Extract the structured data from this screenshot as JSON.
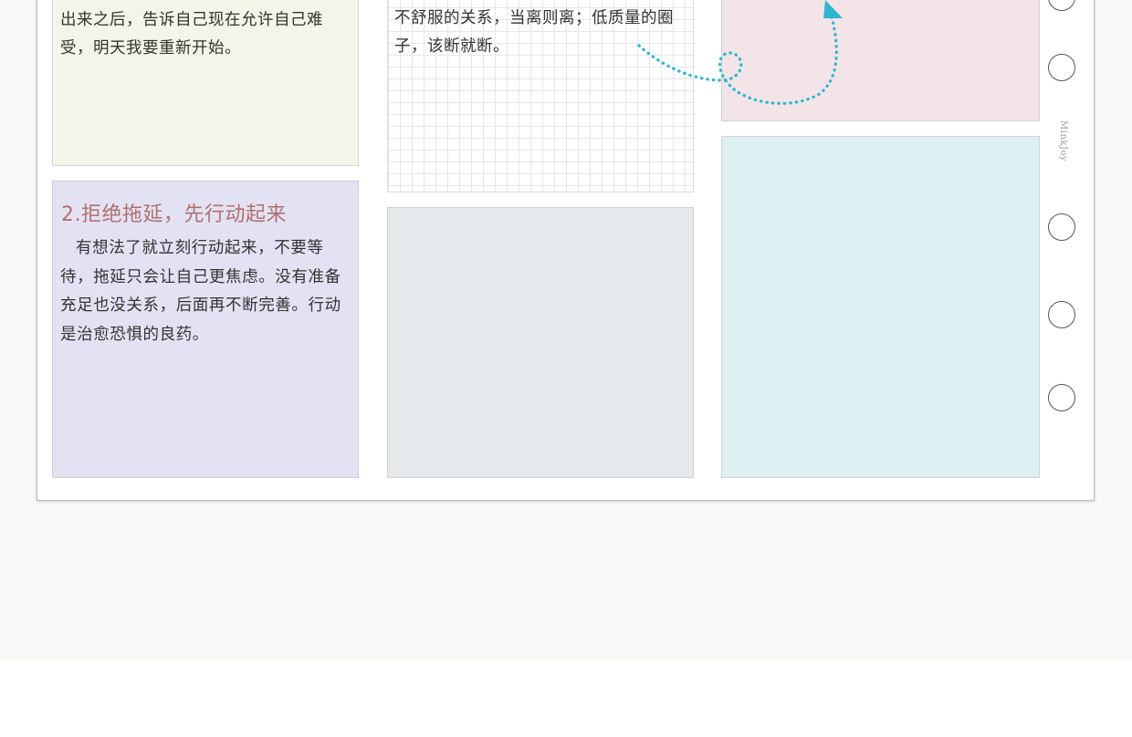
{
  "sheet": {
    "brand": "MinkJoy"
  },
  "notes": {
    "green": {
      "body": "出来之后，告诉自己现在允许自己难受，明天我要重新开始。"
    },
    "grid": {
      "body": "不舒服的关系，当离则离；低质量的圈子，该断就断。"
    },
    "purple": {
      "title": "2.拒绝拖延，先行动起来",
      "body": "有想法了就立刻行动起来，不要等待，拖延只会让自己更焦虑。没有准备充足也没关系，后面再不断完善。行动是治愈恐惧的良药。"
    }
  },
  "colors": {
    "green_card": "#f2f5e8",
    "purple_card": "#e3e2f3",
    "grey_card": "#e6eaed",
    "pink_card": "#f3e4e8",
    "teal_card": "#ddeff0",
    "title_accent": "#b07070",
    "arrow": "#2fb6cf"
  },
  "icons": {
    "arrow": "dotted-loop-arrow-icon",
    "binder_hole": "binder-ring-hole-icon"
  }
}
